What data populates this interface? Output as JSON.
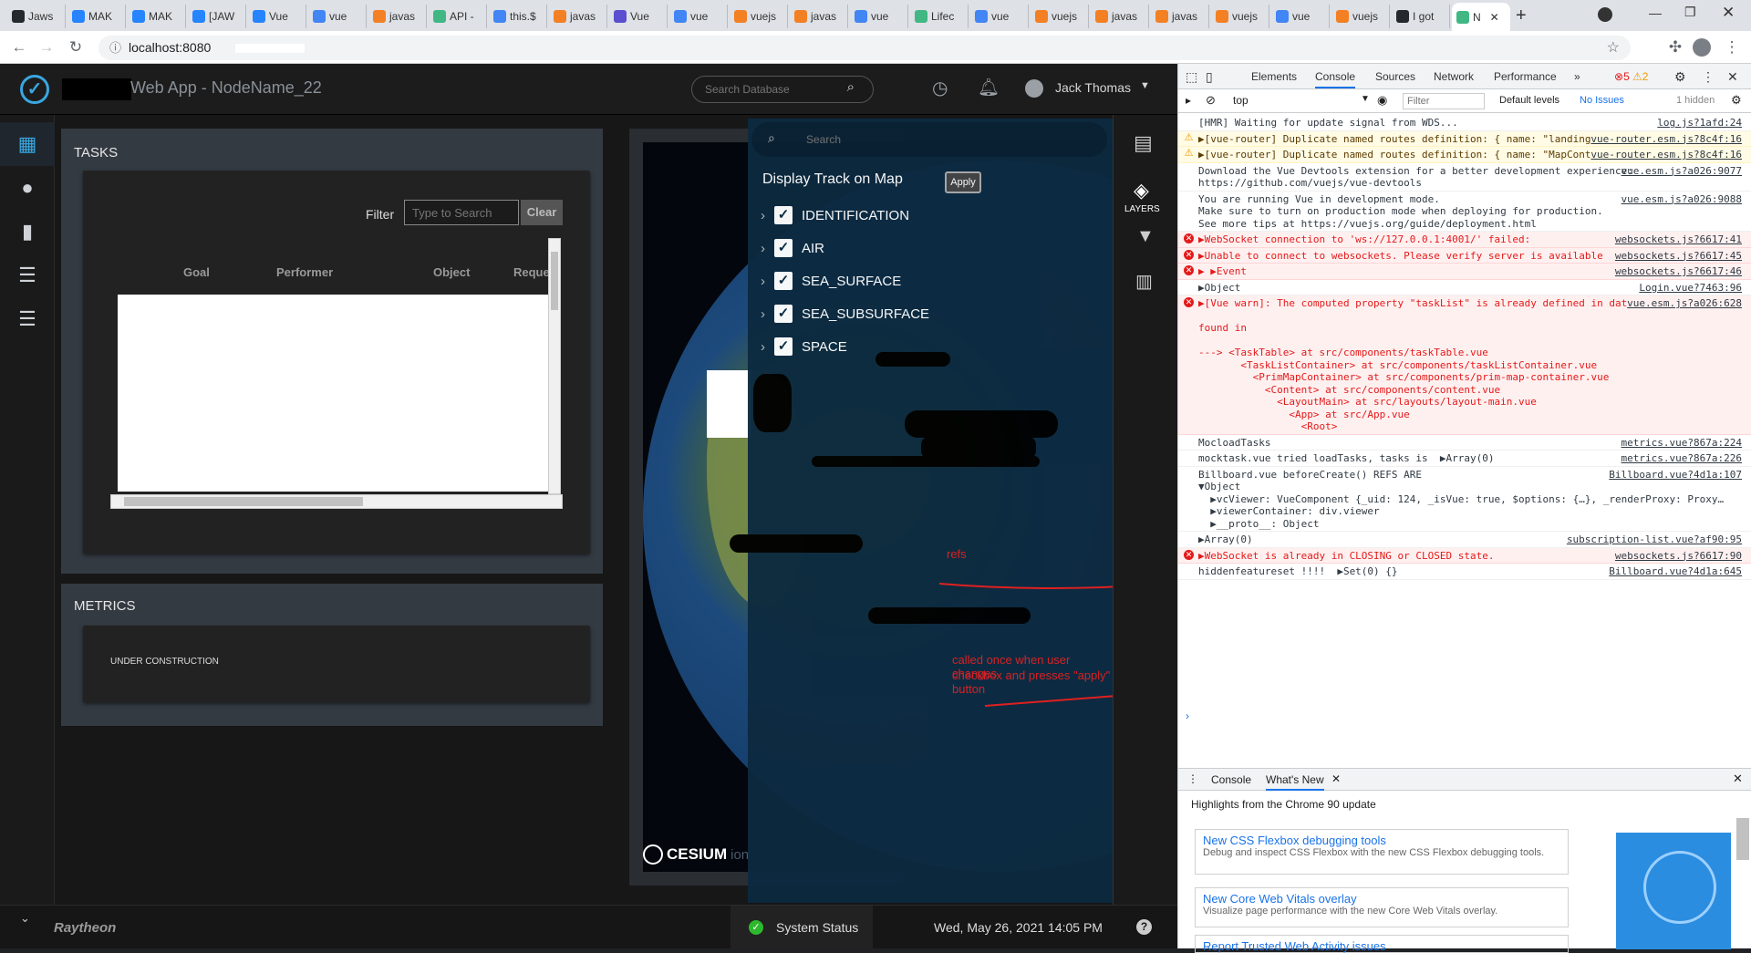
{
  "browser": {
    "tabs": [
      {
        "label": "Jaws",
        "color": "#24292e"
      },
      {
        "label": "MAK",
        "color": "#2684ff"
      },
      {
        "label": "MAK",
        "color": "#2684ff"
      },
      {
        "label": "[JAW",
        "color": "#2684ff"
      },
      {
        "label": "Vue",
        "color": "#2684ff"
      },
      {
        "label": "vue",
        "color": "#4285f4"
      },
      {
        "label": "javas",
        "color": "#f48024"
      },
      {
        "label": "API -",
        "color": "#41b883"
      },
      {
        "label": "this.$",
        "color": "#4285f4"
      },
      {
        "label": "javas",
        "color": "#f48024"
      },
      {
        "label": "Vue",
        "color": "#5a4fcf"
      },
      {
        "label": "vue",
        "color": "#4285f4"
      },
      {
        "label": "vuejs",
        "color": "#f48024"
      },
      {
        "label": "javas",
        "color": "#f48024"
      },
      {
        "label": "vue",
        "color": "#4285f4"
      },
      {
        "label": "Lifec",
        "color": "#41b883"
      },
      {
        "label": "vue",
        "color": "#4285f4"
      },
      {
        "label": "vuejs",
        "color": "#f48024"
      },
      {
        "label": "javas",
        "color": "#f48024"
      },
      {
        "label": "javas",
        "color": "#f48024"
      },
      {
        "label": "vuejs",
        "color": "#f48024"
      },
      {
        "label": "vue",
        "color": "#4285f4"
      },
      {
        "label": "vuejs",
        "color": "#f48024"
      },
      {
        "label": "I got",
        "color": "#24292e"
      },
      {
        "label": "N",
        "color": "#41b883"
      }
    ],
    "url": "localhost:8080"
  },
  "app": {
    "title": "Web App - NodeName_22",
    "search_placeholder": "Search Database",
    "user": "Jack Thomas",
    "nav_icons": [
      "dashboard-icon",
      "globe-icon",
      "bar-chart-icon",
      "list-icon",
      "list-alt-icon"
    ],
    "tasks": {
      "title": "TASKS",
      "filter_label": "Filter",
      "filter_placeholder": "Type to Search",
      "clear_label": "Clear",
      "columns": [
        "Goal",
        "Performer",
        "Object",
        "Reque"
      ]
    },
    "metrics": {
      "title": "METRICS",
      "body": "UNDER CONSTRUCTION"
    },
    "footer": {
      "brand": "Raytheon",
      "status": "System Status",
      "datetime": "Wed, May 26, 2021 14:05 PM"
    }
  },
  "map": {
    "search_placeholder": "Search",
    "display_title": "Display Track on Map",
    "apply_label": "Apply",
    "layers": [
      "IDENTIFICATION",
      "AIR",
      "SEA_SURFACE",
      "SEA_SUBSURFACE",
      "SPACE"
    ],
    "layers_label": "LAYERS",
    "cesium_label": "CESIUM",
    "cesium_suffix": "ion"
  },
  "annotations": {
    "refs": "refs",
    "apply_note_1": "called once when user changes",
    "apply_note_2": "checkbox and presses \"apply\" button"
  },
  "devtools": {
    "tabs": [
      "Elements",
      "Console",
      "Sources",
      "Network",
      "Performance"
    ],
    "errors_count": "5",
    "warnings_count": "2",
    "context": "top",
    "filter_placeholder": "Filter",
    "levels": "Default levels",
    "issues": "No Issues",
    "hidden": "1 hidden",
    "lines": [
      {
        "type": "info",
        "text": "[HMR] Waiting for update signal from WDS...",
        "src": "log.js?1afd:24"
      },
      {
        "type": "warn",
        "text": "▶[vue-router] Duplicate named routes definition: { name: \"landing\", path: \"/landing\" }",
        "src": "vue-router.esm.js?8c4f:16"
      },
      {
        "type": "warn",
        "text": "▶[vue-router] Duplicate named routes definition: { name: \"MapContainer\", path: \"/map\" }",
        "src": "vue-router.esm.js?8c4f:16"
      },
      {
        "type": "info",
        "text": "Download the Vue Devtools extension for a better development experience:\nhttps://github.com/vuejs/vue-devtools",
        "src": "vue.esm.js?a026:9077"
      },
      {
        "type": "info",
        "text": "You are running Vue in development mode.\nMake sure to turn on production mode when deploying for production.\nSee more tips at https://vuejs.org/guide/deployment.html",
        "src": "vue.esm.js?a026:9088"
      },
      {
        "type": "err",
        "text": "▶WebSocket connection to 'ws://127.0.0.1:4001/' failed:",
        "src": "websockets.js?6617:41"
      },
      {
        "type": "err",
        "text": "▶Unable to connect to websockets. Please verify server is available",
        "src": "websockets.js?6617:45"
      },
      {
        "type": "err",
        "text": "▶ ▶Event",
        "src": "websockets.js?6617:46"
      },
      {
        "type": "info",
        "text": "▶Object",
        "src": "Login.vue?7463:96"
      },
      {
        "type": "err",
        "text": "▶[Vue warn]: The computed property \"taskList\" is already defined in data.\n\nfound in\n\n---> <TaskTable> at src/components/taskTable.vue\n       <TaskListContainer> at src/components/taskListContainer.vue\n         <PrimMapContainer> at src/components/prim-map-container.vue\n           <Content> at src/components/content.vue\n             <LayoutMain> at src/layouts/layout-main.vue\n               <App> at src/App.vue\n                 <Root>",
        "src": "vue.esm.js?a026:628"
      },
      {
        "type": "info",
        "text": "MocloadTasks",
        "src": "metrics.vue?867a:224"
      },
      {
        "type": "info",
        "text": "mocktask.vue tried loadTasks, tasks is  ▶Array(0)",
        "src": "metrics.vue?867a:226"
      },
      {
        "type": "info",
        "text": "Billboard.vue beforeCreate() REFS ARE\n▼Object\n  ▶vcViewer: VueComponent {_uid: 124, _isVue: true, $options: {…}, _renderProxy: Proxy…\n  ▶viewerContainer: div.viewer\n  ▶__proto__: Object",
        "src": "Billboard.vue?4d1a:107"
      },
      {
        "type": "info",
        "text": "▶Array(0)",
        "src": "subscription-list.vue?af90:95"
      },
      {
        "type": "err",
        "text": "▶WebSocket is already in CLOSING or CLOSED state.",
        "src": "websockets.js?6617:90"
      },
      {
        "type": "info",
        "text": "hiddenfeatureset !!!!  ▶Set(0) {}",
        "src": "Billboard.vue?4d1a:645"
      }
    ],
    "drawer_tabs": [
      "Console",
      "What's New"
    ],
    "drawer_heading": "Highlights from the Chrome 90 update",
    "cards": [
      {
        "title": "New CSS Flexbox debugging tools",
        "desc": "Debug and inspect CSS Flexbox with the new CSS Flexbox debugging tools."
      },
      {
        "title": "New Core Web Vitals overlay",
        "desc": "Visualize page performance with the new Core Web Vitals overlay."
      },
      {
        "title": "Report Trusted Web Activity issues",
        "desc": ""
      }
    ]
  }
}
